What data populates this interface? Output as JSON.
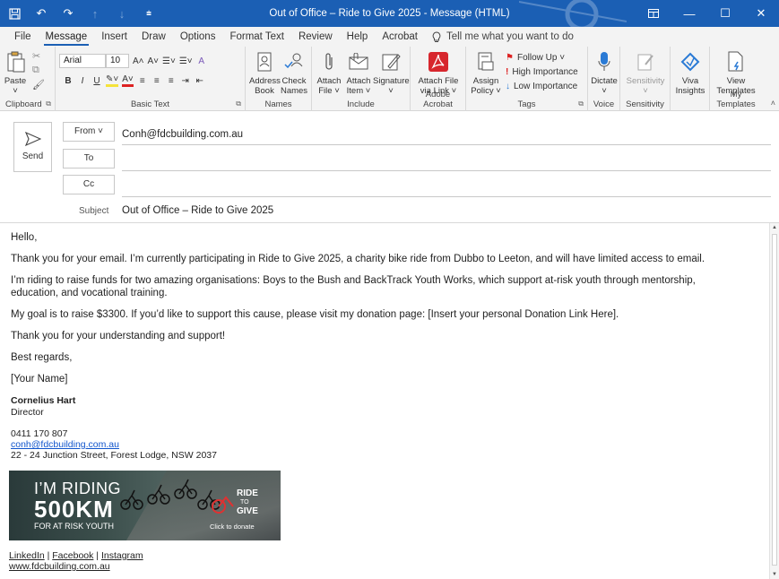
{
  "window": {
    "title": "Out of Office – Ride to Give 2025  -  Message (HTML)",
    "accent": "#1b5fb4"
  },
  "tabs": [
    "File",
    "Message",
    "Insert",
    "Draw",
    "Options",
    "Format Text",
    "Review",
    "Help",
    "Acrobat"
  ],
  "tell_me": "Tell me what you want to do",
  "ribbon": {
    "clipboard": {
      "paste": "Paste",
      "label": "Clipboard"
    },
    "basic_text": {
      "font": "Arial",
      "size": "10",
      "bold": "B",
      "italic": "I",
      "underline": "U",
      "label": "Basic Text"
    },
    "names": {
      "address_book": [
        "Address",
        "Book"
      ],
      "check_names": [
        "Check",
        "Names"
      ],
      "label": "Names"
    },
    "include": {
      "attach_file": [
        "Attach",
        "File ˅"
      ],
      "attach_item": [
        "Attach",
        "Item ˅"
      ],
      "signature": [
        "Signature",
        "˅"
      ],
      "label": "Include"
    },
    "adobe": {
      "attach_link": [
        "Attach File",
        "via Link ˅"
      ],
      "label": "Adobe Acrobat"
    },
    "tags": {
      "assign_policy": [
        "Assign",
        "Policy ˅"
      ],
      "follow_up": "Follow Up ˅",
      "high": "High Importance",
      "low": "Low Importance",
      "label": "Tags"
    },
    "voice": {
      "dictate": [
        "Dictate",
        "˅"
      ],
      "label": "Voice"
    },
    "sensitivity": {
      "btn": [
        "Sensitivity",
        "˅"
      ],
      "label": "Sensitivity"
    },
    "viva": {
      "btn": [
        "Viva",
        "Insights"
      ]
    },
    "templates": {
      "btn": [
        "View",
        "Templates"
      ],
      "label": "My Templates"
    }
  },
  "compose": {
    "send": "Send",
    "from_label": "From ˅",
    "from_value": "Conh@fdcbuilding.com.au",
    "to_label": "To",
    "cc_label": "Cc",
    "subject_label": "Subject",
    "subject_value": "Out of Office – Ride to Give 2025"
  },
  "body": {
    "greeting": "Hello,",
    "p1": "Thank you for your email. I’m currently participating in Ride to Give 2025, a charity bike ride from Dubbo to Leeton, and will have limited access to email.",
    "p2a": "I’m riding to raise funds for two amazing organisations: Boys to the Bush and BackTrack Youth Works, which support at-risk youth through mentorship,",
    "p2b": "education, and vocational training.",
    "p3": "My goal is to raise $3300. If you’d like to support this cause, please visit my donation page: [Insert your personal Donation Link Here].",
    "p4": "Thank you for your understanding and support!",
    "p5": "Best regards,",
    "p6": "[Your Name]"
  },
  "signature": {
    "name": "Cornelius Hart",
    "title": "Director",
    "phone": "0411 170 807",
    "email": "conh@fdcbuilding.com.au",
    "address": "22 - 24 Junction Street, Forest Lodge, NSW 2037",
    "banner": {
      "line1": "I’M RIDING",
      "line2": "500KM",
      "line3": "FOR AT RISK YOUTH",
      "logo_a": "RIDE",
      "logo_b": "TO",
      "logo_c": "GIVE",
      "cta": "Click to donate"
    },
    "social": [
      "LinkedIn",
      "Facebook",
      "Instagram"
    ],
    "separator": " | ",
    "website": "www.fdcbuilding.com.au"
  }
}
